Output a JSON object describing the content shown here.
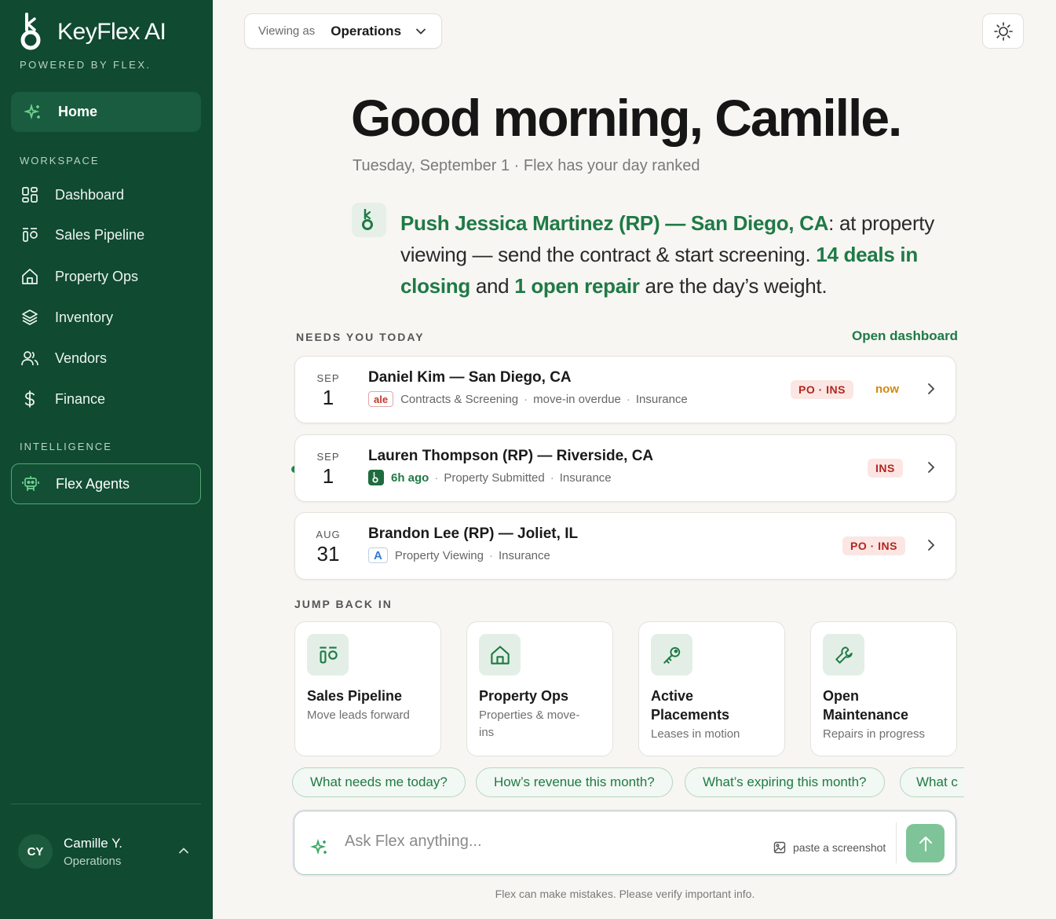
{
  "brand": {
    "name": "KeyFlex AI",
    "tagline": "POWERED BY FLEX."
  },
  "nav": {
    "home": "Home",
    "workspace_label": "WORKSPACE",
    "items": [
      "Dashboard",
      "Sales Pipeline",
      "Property Ops",
      "Inventory",
      "Vendors",
      "Finance"
    ],
    "intelligence_label": "INTELLIGENCE",
    "agents": "Flex Agents"
  },
  "user": {
    "initials": "CY",
    "name": "Camille Y.",
    "role": "Operations"
  },
  "topbar": {
    "viewing_prefix": "Viewing as",
    "viewing_value": "Operations"
  },
  "greeting": {
    "title": "Good morning, Camille.",
    "subline": "Tuesday, September 1 · Flex has your day ranked"
  },
  "brief": {
    "lead": "Push Jessica Martinez (RP) — San Diego, CA",
    "part1": ": at property viewing — send the contract & start screening. ",
    "deals": "14 deals in closing",
    "part2": " and ",
    "repair": "1 open repair",
    "part3": " are the day’s weight."
  },
  "needs": {
    "label": "NEEDS YOU TODAY",
    "open_dashboard": "Open dashboard",
    "tasks": [
      {
        "month": "SEP",
        "day": "1",
        "title": "Daniel Kim — San Diego, CA",
        "tag": "ale",
        "meta1": "Contracts & Screening",
        "meta2": "move-in overdue",
        "meta3": "Insurance",
        "badge": "PO · INS",
        "status": "now"
      },
      {
        "month": "SEP",
        "day": "1",
        "title": "Lauren Thompson (RP) — Riverside, CA",
        "ago": "6h ago",
        "meta1": "Property Submitted",
        "meta2": "Insurance",
        "badge": "INS"
      },
      {
        "month": "AUG",
        "day": "31",
        "title": "Brandon Lee (RP) — Joliet, IL",
        "tag": "A",
        "meta1": "Property Viewing",
        "meta2": "Insurance",
        "badge": "PO · INS"
      }
    ]
  },
  "jump": {
    "label": "JUMP BACK IN",
    "cards": [
      {
        "title": "Sales Pipeline",
        "sub": "Move leads forward",
        "icon": "pipeline-icon"
      },
      {
        "title": "Property Ops",
        "sub": "Properties & move-ins",
        "icon": "home-icon"
      },
      {
        "title": "Active Placements",
        "sub": "Leases in motion",
        "icon": "key-icon"
      },
      {
        "title": "Open Maintenance",
        "sub": "Repairs in progress",
        "icon": "wrench-icon"
      }
    ]
  },
  "chips": [
    "What needs me today?",
    "How’s revenue this month?",
    "What’s expiring this month?",
    "What c"
  ],
  "ask": {
    "placeholder": "Ask Flex anything...",
    "paste": "paste a screenshot"
  },
  "disclaimer": "Flex can make mistakes. Please verify important info.",
  "colors": {
    "sidebar": "#0f4a31",
    "accent": "#1f7a45",
    "badge_bg": "#fbe6e4",
    "badge_text": "#b3261e",
    "now": "#d08a12"
  }
}
